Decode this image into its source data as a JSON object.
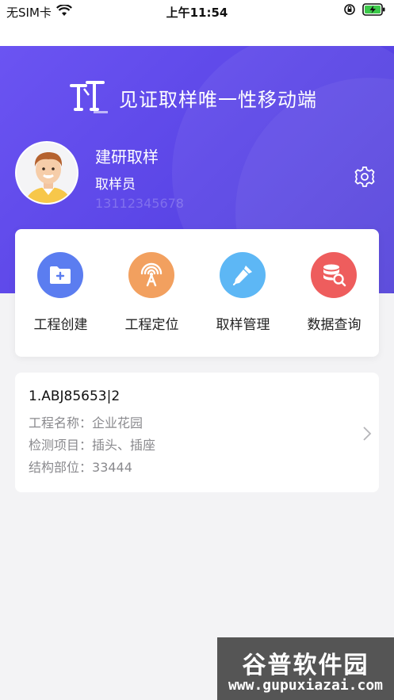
{
  "status_bar": {
    "carrier": "无SIM卡",
    "time": "上午11:54"
  },
  "header": {
    "app_title": "见证取样唯一性移动端",
    "user_name": "建研取样",
    "user_role": "取样员",
    "user_phone": "13112345678"
  },
  "menu": [
    {
      "label": "工程创建",
      "icon": "folder-add-icon",
      "color": "#5b7df0"
    },
    {
      "label": "工程定位",
      "icon": "signal-tower-icon",
      "color": "#f2a05f"
    },
    {
      "label": "取样管理",
      "icon": "dropper-icon",
      "color": "#5db7f5"
    },
    {
      "label": "数据查询",
      "icon": "database-search-icon",
      "color": "#ee5d5d"
    }
  ],
  "project": {
    "code": "1.ABJ85653|2",
    "name_label": "工程名称：",
    "name_value": "企业花园",
    "item_label": "检测项目：",
    "item_value": "插头、插座",
    "part_label": "结构部位：",
    "part_value": "33444"
  },
  "watermark": {
    "title": "谷普软件园",
    "url": "www.gupuxiazai.com"
  },
  "colors": {
    "header_primary": "#5a45e6",
    "background": "#f3f3f5"
  }
}
